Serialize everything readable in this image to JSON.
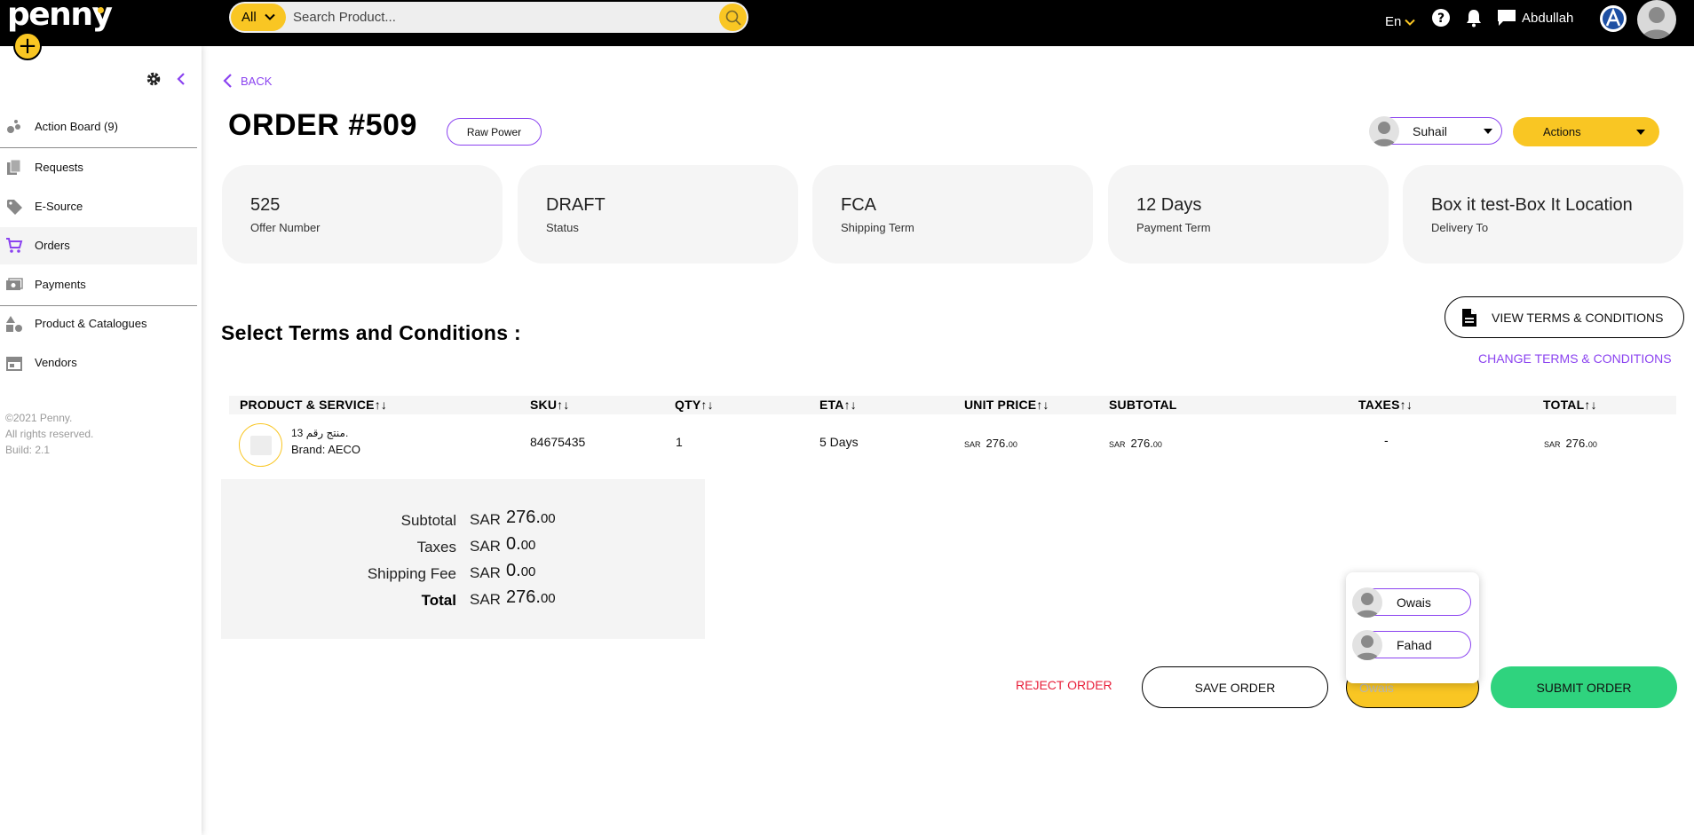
{
  "app": {
    "logo": "penny"
  },
  "search": {
    "category": "All",
    "placeholder": "Search Product..."
  },
  "header": {
    "language": "En",
    "user_name": "Abdullah"
  },
  "sidebar": {
    "items": [
      {
        "label": "Action Board (9)"
      },
      {
        "label": "Requests"
      },
      {
        "label": "E-Source"
      },
      {
        "label": "Orders"
      },
      {
        "label": "Payments"
      },
      {
        "label": "Product & Catalogues"
      },
      {
        "label": "Vendors"
      }
    ],
    "footer": {
      "copyright": "©2021 Penny.",
      "rights": "All rights reserved.",
      "build": "Build: 2.1"
    }
  },
  "page": {
    "back_label": "BACK",
    "title": "ORDER #509",
    "tag": "Raw Power",
    "assignee": "Suhail",
    "actions_label": "Actions"
  },
  "cards": [
    {
      "value": "525",
      "label": "Offer Number"
    },
    {
      "value": "DRAFT",
      "label": "Status"
    },
    {
      "value": "FCA",
      "label": "Shipping Term"
    },
    {
      "value": "12 Days",
      "label": "Payment Term"
    },
    {
      "value": "Box it test-Box It Location",
      "label": "Delivery To"
    }
  ],
  "terms": {
    "section_title": "Select Terms and Conditions :",
    "view_label": "VIEW TERMS & CONDITIONS",
    "change_label": "CHANGE TERMS & CONDITIONS"
  },
  "table": {
    "headers": {
      "product": "PRODUCT & SERVICE",
      "sku": "SKU",
      "qty": "QTY",
      "eta": "ETA",
      "unit_price": "UNIT PRICE",
      "subtotal": "SUBTOTAL",
      "taxes": "TAXES",
      "total": "TOTAL",
      "sort_icon": "↑↓"
    },
    "rows": [
      {
        "product_name": "منتج رقم 13.",
        "brand": "Brand: AECO",
        "sku": "84675435",
        "qty": "1",
        "eta": "5 Days",
        "currency": "SAR",
        "unit_price_int": "276.",
        "unit_price_dec": "00",
        "subtotal_int": "276.",
        "subtotal_dec": "00",
        "taxes": "-",
        "total_int": "276.",
        "total_dec": "00"
      }
    ]
  },
  "summary": {
    "currency": "SAR",
    "rows": [
      {
        "label": "Subtotal",
        "int": "276.",
        "dec": "00"
      },
      {
        "label": "Taxes",
        "int": "0.",
        "dec": "00"
      },
      {
        "label": "Shipping Fee",
        "int": "0.",
        "dec": "00"
      },
      {
        "label": "Total",
        "int": "276.",
        "dec": "00"
      }
    ]
  },
  "footer_actions": {
    "reject": "REJECT ORDER",
    "save": "SAVE ORDER",
    "assign_value": "Owais",
    "submit": "SUBMIT ORDER"
  },
  "assign_dropdown": {
    "options": [
      {
        "name": "Owais"
      },
      {
        "name": "Fahad"
      }
    ]
  },
  "colors": {
    "accent_yellow": "#f9c623",
    "accent_purple": "#8b43f0",
    "success_green": "#2fd37e",
    "danger_red": "#e8203b"
  }
}
